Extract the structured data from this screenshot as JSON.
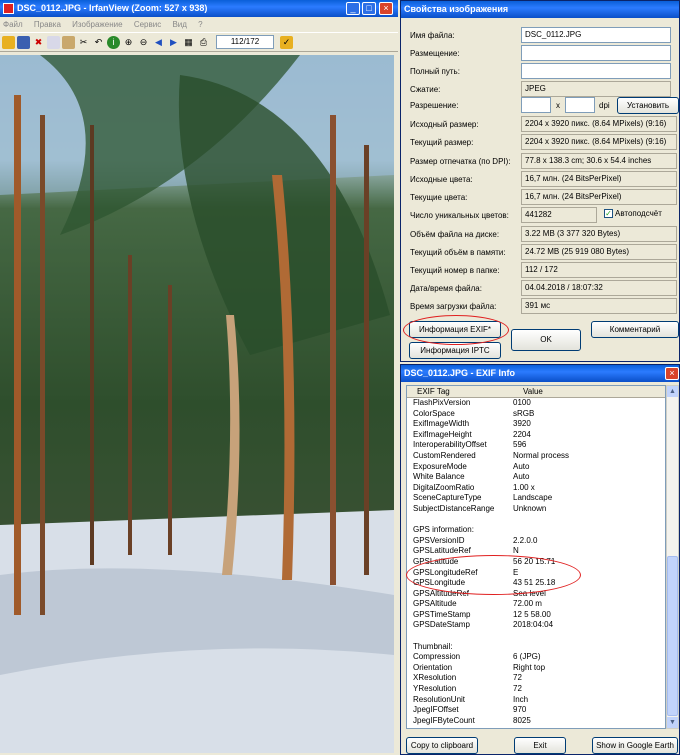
{
  "irfan": {
    "title": "DSC_0112.JPG - IrfanView (Zoom: 527 x 938)",
    "menu": [
      "Файл",
      "Правка",
      "Изображение",
      "Сервис",
      "Вид",
      "?"
    ],
    "page_counter": "112/172"
  },
  "props": {
    "title": "Свойства изображения",
    "rows": [
      {
        "label": "Имя файла:",
        "value": "DSC_0112.JPG"
      },
      {
        "label": "Размещение:",
        "value": ""
      },
      {
        "label": "Полный путь:",
        "value": ""
      },
      {
        "label": "Сжатие:",
        "value": "JPEG"
      },
      {
        "label": "Исходный размер:",
        "value": "2204 x 3920  пикс. (8.64 MPixels) (9:16)"
      },
      {
        "label": "Текущий размер:",
        "value": "2204 x 3920  пикс. (8.64 MPixels) (9:16)"
      },
      {
        "label": "Размер отпечатка (по DPI):",
        "value": "77.8 x 138.3 cm; 30.6 x 54.4 inches"
      },
      {
        "label": "Исходные цвета:",
        "value": "16,7 млн.   (24 BitsPerPixel)"
      },
      {
        "label": "Текущие цвета:",
        "value": "16,7 млн.   (24 BitsPerPixel)"
      },
      {
        "label": "Число уникальных цветов:",
        "value": "441282"
      },
      {
        "label": "Объём файла на диске:",
        "value": "3.22 MB (3 377 320 Bytes)"
      },
      {
        "label": "Текущий объём в памяти:",
        "value": "24.72  MB (25 919 080 Bytes)"
      },
      {
        "label": "Текущий номер в папке:",
        "value": "112  /  172"
      },
      {
        "label": "Дата/время файла:",
        "value": "04.04.2018 / 18:07:32"
      },
      {
        "label": "Время загрузки файла:",
        "value": "391 мс"
      }
    ],
    "resolution_label": "Разрешение:",
    "resolution_x": "x",
    "resolution_unit": "dpi",
    "set_button": "Установить",
    "auto_count": "Автоподсчёт",
    "exif_button": "Информация EXIF*",
    "iptc_button": "Информация IPTC",
    "ok_button": "OK",
    "comment_button": "Комментарий"
  },
  "exif": {
    "title": "DSC_0112.JPG - EXIF Info",
    "col_tag": "EXIF Tag",
    "col_value": "Value",
    "rows": [
      [
        "FlashPixVersion",
        "0100"
      ],
      [
        "ColorSpace",
        "sRGB"
      ],
      [
        "ExifImageWidth",
        "3920"
      ],
      [
        "ExifImageHeight",
        "2204"
      ],
      [
        "InteroperabilityOffset",
        "596"
      ],
      [
        "CustomRendered",
        "Normal process"
      ],
      [
        "ExposureMode",
        "Auto"
      ],
      [
        "White Balance",
        "Auto"
      ],
      [
        "DigitalZoomRatio",
        "1.00 x"
      ],
      [
        "SceneCaptureType",
        "Landscape"
      ],
      [
        "SubjectDistanceRange",
        "Unknown"
      ],
      [
        "",
        ""
      ],
      [
        "GPS information:",
        ""
      ],
      [
        "GPSVersionID",
        "2.2.0.0"
      ],
      [
        "GPSLatitudeRef",
        "N"
      ],
      [
        "GPSLatitude",
        "56  20  15.71"
      ],
      [
        "GPSLongitudeRef",
        "E"
      ],
      [
        "GPSLongitude",
        "43  51  25.18"
      ],
      [
        "GPSAltitudeRef",
        "Sea level"
      ],
      [
        "GPSAltitude",
        "72.00 m"
      ],
      [
        "GPSTimeStamp",
        "12  5  58.00"
      ],
      [
        "GPSDateStamp",
        "2018:04:04"
      ],
      [
        "",
        ""
      ],
      [
        "Thumbnail:",
        ""
      ],
      [
        "Compression",
        "6 (JPG)"
      ],
      [
        "Orientation",
        "Right top"
      ],
      [
        "XResolution",
        "72"
      ],
      [
        "YResolution",
        "72"
      ],
      [
        "ResolutionUnit",
        "Inch"
      ],
      [
        "JpegIFOffset",
        "970"
      ],
      [
        "JpegIFByteCount",
        "8025"
      ]
    ],
    "copy_button": "Copy to clipboard",
    "exit_button": "Exit",
    "google_button": "Show in Google Earth"
  },
  "colors": {
    "titlebar": "#0a5fd8",
    "annotation": "#e02020"
  }
}
